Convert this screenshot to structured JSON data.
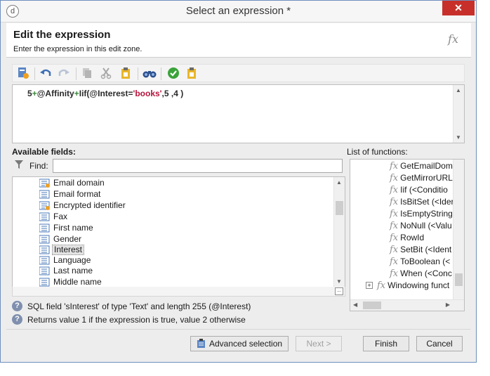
{
  "window": {
    "title": "Select an expression *",
    "close_glyph": "✕",
    "app_icon": "d"
  },
  "header": {
    "title": "Edit the expression",
    "subtitle": "Enter the expression in this edit zone.",
    "icon": "fx-icon",
    "fx_glyph": "fx"
  },
  "toolbar": {
    "items": [
      "new-expression-icon",
      "undo-icon",
      "redo-icon",
      "copy-icon",
      "cut-icon",
      "paste-icon",
      "search-binoculars-icon",
      "check-icon",
      "clipboard-icon"
    ]
  },
  "editor": {
    "expr_parts": [
      "5",
      "+",
      "@Affinity",
      "+",
      "Iif(@Interest=",
      "'books'",
      ",5 ,4 )"
    ]
  },
  "fields": {
    "label": "Available fields:",
    "find_label": "Find:",
    "find_value": "",
    "items": [
      "Email domain",
      "Email format",
      "Encrypted identifier",
      "Fax",
      "First name",
      "Gender",
      "Interest",
      "Language",
      "Last name",
      "Middle name"
    ],
    "selected": "Interest",
    "ellipsis": "..."
  },
  "functions": {
    "label": "List of functions:",
    "fx_glyph": "fx",
    "items": [
      "GetEmailDom",
      "GetMirrorURL",
      "Iif (<Conditio",
      "IsBitSet (<Ider",
      "IsEmptyString",
      "NoNull (<Valu",
      "RowId",
      "SetBit (<Ident",
      "ToBoolean (<",
      "When (<Conc"
    ],
    "group": "Windowing funct",
    "expand_glyph": "+"
  },
  "help": {
    "line1": "SQL field 'sInterest' of type 'Text' and length 255 (@Interest)",
    "line2": "Returns value 1 if the expression is true, value 2 otherwise",
    "icon_glyph": "?"
  },
  "buttons": {
    "advanced": "Advanced selection",
    "next": "Next >",
    "finish": "Finish",
    "cancel": "Cancel"
  },
  "colors": {
    "operator": "#3c8a3c",
    "string_literal": "#b3123a",
    "close_button": "#c7302a"
  }
}
